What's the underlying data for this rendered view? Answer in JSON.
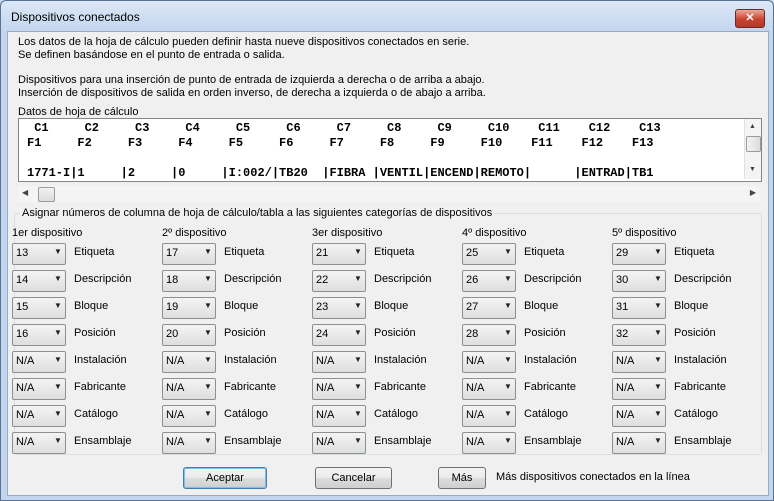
{
  "window": {
    "title": "Dispositivos conectados",
    "close_label": "✕"
  },
  "description": {
    "line1": "Los datos de la hoja de cálculo pueden definir hasta nueve dispositivos conectados en serie.",
    "line2": "Se definen basándose en el punto de entrada o salida.",
    "line3": "Dispositivos para una inserción de punto de entrada de izquierda a derecha o de arriba a abajo.",
    "line4": "Inserción de dispositivos de salida en orden inverso, de derecha a izquierda o de abajo a arriba."
  },
  "sheet": {
    "label": "Datos de hoja de cálculo",
    "line1": " C1     C2     C3     C4     C5     C6     C7     C8     C9     C10    C11    C12    C13",
    "line2": "F1     F2     F3     F4     F5     F6     F7     F8     F9     F10    F11    F12    F13",
    "line3": "",
    "line4": "1771-I|1     |2     |0     |I:002/|TB20  |FIBRA |VENTIL|ENCEND|REMOTO|      |ENTRAD|TB1"
  },
  "group": {
    "title": "Asignar números de columna de hoja de cálculo/tabla a las siguientes categorías de dispositivos"
  },
  "labels": [
    "Etiqueta",
    "Descripción",
    "Bloque",
    "Posición",
    "Instalación",
    "Fabricante",
    "Catálogo",
    "Ensamblaje"
  ],
  "devices": [
    {
      "heading": "1er dispositivo",
      "values": [
        "13",
        "14",
        "15",
        "16",
        "N/A",
        "N/A",
        "N/A",
        "N/A"
      ]
    },
    {
      "heading": "2º dispositivo",
      "values": [
        "17",
        "18",
        "19",
        "20",
        "N/A",
        "N/A",
        "N/A",
        "N/A"
      ]
    },
    {
      "heading": "3er dispositivo",
      "values": [
        "21",
        "22",
        "23",
        "24",
        "N/A",
        "N/A",
        "N/A",
        "N/A"
      ]
    },
    {
      "heading": "4º dispositivo",
      "values": [
        "25",
        "26",
        "27",
        "28",
        "N/A",
        "N/A",
        "N/A",
        "N/A"
      ]
    },
    {
      "heading": "5º dispositivo",
      "values": [
        "29",
        "30",
        "31",
        "32",
        "N/A",
        "N/A",
        "N/A",
        "N/A"
      ]
    }
  ],
  "buttons": {
    "accept": "Aceptar",
    "cancel": "Cancelar",
    "more": "Más",
    "more_description": "Más dispositivos conectados en la línea"
  }
}
